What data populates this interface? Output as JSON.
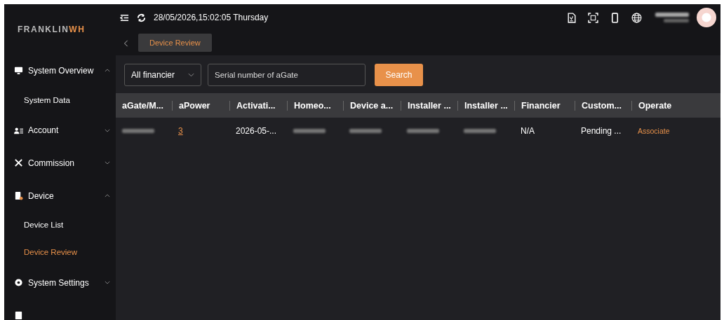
{
  "logo": {
    "main": "FRANKLIN",
    "accent": "WH"
  },
  "header": {
    "datetime": "28/05/2026,15:02:05 Thursday"
  },
  "tabs": [
    {
      "label": "Device Review",
      "selected": true
    }
  ],
  "sidebar": {
    "items": [
      {
        "label": "System Overview",
        "kind": "monitor",
        "expanded": true,
        "children": [
          {
            "label": "System Data",
            "selected": false
          }
        ]
      },
      {
        "label": "Account",
        "kind": "account",
        "expanded": false
      },
      {
        "label": "Commission",
        "kind": "tools",
        "expanded": false
      },
      {
        "label": "Device",
        "kind": "device",
        "expanded": true,
        "children": [
          {
            "label": "Device List",
            "selected": false
          },
          {
            "label": "Device Review",
            "selected": true
          }
        ]
      },
      {
        "label": "System Settings",
        "kind": "gear",
        "expanded": false
      }
    ]
  },
  "filters": {
    "financier": "All financier",
    "serial_placeholder": "Serial number of aGate",
    "search_button": "Search"
  },
  "table": {
    "columns": [
      "aGate/M...",
      "aPower",
      "Activati...",
      "Homeo...",
      "Device a...",
      "Installer ...",
      "Installer ...",
      "Financier",
      "Custom...",
      "Operate"
    ],
    "rows": [
      {
        "cells": [
          {
            "kind": "redacted"
          },
          {
            "kind": "link",
            "text": "3"
          },
          {
            "kind": "text",
            "text": "2026-05-..."
          },
          {
            "kind": "redacted"
          },
          {
            "kind": "redacted"
          },
          {
            "kind": "redacted"
          },
          {
            "kind": "redacted"
          },
          {
            "kind": "text",
            "text": "N/A"
          },
          {
            "kind": "text",
            "text": "Pending ..."
          },
          {
            "kind": "action",
            "text": "Associate"
          }
        ]
      }
    ]
  }
}
